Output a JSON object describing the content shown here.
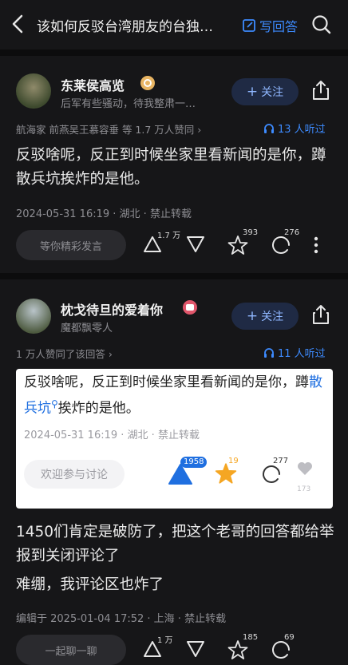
{
  "header": {
    "title": "该如何反驳台湾朋友的台独…",
    "write_answer": "写回答"
  },
  "answer1": {
    "author": "东莱侯高览",
    "bio": "后军有些骚动，待我整肃一…",
    "follow": "关注",
    "endorsement": "航海家 前燕吴王慕容垂 等 1.7 万人赞同 ›",
    "listeners": "13 人听过",
    "text": "反驳啥呢，反正到时候坐家里看新闻的是你，蹲散兵坑挨炸的是他。",
    "meta": "2024-05-31 16:19 · 湖北 · 禁止转载",
    "comment_placeholder": "等你精彩发言",
    "upvotes": "1.7 万",
    "stars": "393",
    "comments": "276"
  },
  "answer2": {
    "author": "枕戈待旦的爱着你",
    "bio": "魔都飘零人",
    "follow": "关注",
    "endorsement": "1 万人赞同了该回答 ›",
    "listeners": "11 人听过",
    "quote": {
      "text_before": "反驳啥呢，反正到时候坐家里看新闻的是你，蹲",
      "link": "散兵坑",
      "text_after": "挨炸的是他。",
      "meta": "2024-05-31 16:19 · 湖北 · 禁止转载",
      "discuss": "欢迎参与讨论",
      "upvotes": "1958",
      "stars": "19",
      "comments": "277",
      "likes": "173"
    },
    "text1": "1450们肯定是破防了，把这个老哥的回答都给举报到关闭评论了",
    "text2": "难绷，我评论区也炸了",
    "meta": "编辑于 2025-01-04 17:52 · 上海 · 禁止转载",
    "comment_placeholder": "一起聊一聊",
    "upvotes": "1 万",
    "stars": "185",
    "comments": "69"
  },
  "colors": {
    "accent": "#3d8bff",
    "star": "#f5a623",
    "card_blue": "#1f6fe0"
  }
}
